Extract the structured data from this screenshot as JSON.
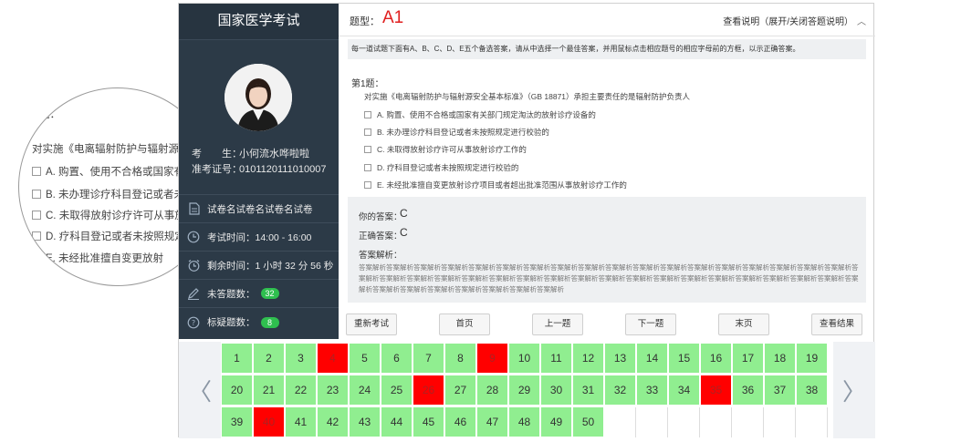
{
  "magnifier": {
    "lines": [
      "题：",
      "对实施《电离辐射防护与辐射源安",
      "A. 购置、使用不合格或国家有关",
      "B. 未办理诊疗科目登记或者未按",
      "C. 未取得放射诊疗许可从事放射",
      "D. 疗科目登记或者未按照规定",
      "E. 未经批准擅自变更放射"
    ]
  },
  "sidebar": {
    "title": "国家医学考试",
    "candidate_label": "考　　生：",
    "candidate_name": "小何流水哗啦啦",
    "ticket_label": "准考证号：",
    "ticket_no": "0101120111010007",
    "items": [
      {
        "icon": "document-icon",
        "label": "试卷名试卷名试卷名试卷"
      },
      {
        "icon": "clock-icon",
        "label": "考试时间：14:00 - 16:00"
      },
      {
        "icon": "alarm-clock-icon",
        "label": "剩余时间：1 小时 32 分 56 秒"
      },
      {
        "icon": "pencil-icon",
        "label": "未答题数：",
        "badge": "32"
      },
      {
        "icon": "question-circle-icon",
        "label": "标疑题数：",
        "badge": "8"
      }
    ]
  },
  "header": {
    "qtype_label": "题型：",
    "qtype_value": "A1",
    "toggle_help": "查看说明（展开/关闭答题说明）"
  },
  "notice": "每一道试题下面有A、B、C、D、E五个备选答案，请从中选择一个最佳答案，并用鼠标点击相应题号的相应字母前的方框，以示正确答案。",
  "question": {
    "number": "第1题：",
    "stem": "对实施《电离辐射防护与辐射源安全基本标准》（GB 18871）承担主要责任的是辐射防护负责人",
    "options": [
      "A. 购置、使用不合格或国家有关部门规定淘汰的放射诊疗设备的",
      "B. 未办理诊疗科目登记或者未按照规定进行校验的",
      "C. 未取得放射诊疗许可从事放射诊疗工作的",
      "D. 疗科目登记或者未按照规定进行校验的",
      "E. 未经批准擅自变更放射诊疗项目或者超出批准范围从事放射诊疗工作的"
    ]
  },
  "answer": {
    "your_label": "你的答案：",
    "your_value": "C",
    "correct_label": "正确答案：",
    "correct_value": "C",
    "analysis_label": "答案解析：",
    "analysis_text": "答案解析答案解析答案解析答案解析答案解析答案解析答案解析答案解析答案解析答案解析答案解析答案解析答案解析答案解析答案解析答案解析答案解析答案解析答案解析答案解析答案解析答案解析答案解析答案解析答案解析答案解析答案解析答案解析答案解析答案解析答案解析答案解析答案解析答案解析答案解析答案解析答案解析答案解析答案解析答案解析答案解析答案解析答案解析答案解析"
  },
  "buttons": [
    "重新考试",
    "首页",
    "上一题",
    "下一题",
    "末页",
    "查看结果"
  ],
  "grid": {
    "total": 50,
    "wrong": [
      4,
      9,
      26,
      35,
      40
    ],
    "prev_icon": "chevron-left-icon",
    "next_icon": "chevron-right-icon"
  },
  "colors": {
    "sidebar_bg": "#2c3a47",
    "answered": "#90ee90",
    "wrong": "#ff0000",
    "qtype": "#e02020",
    "badge": "#2fbf4f"
  }
}
